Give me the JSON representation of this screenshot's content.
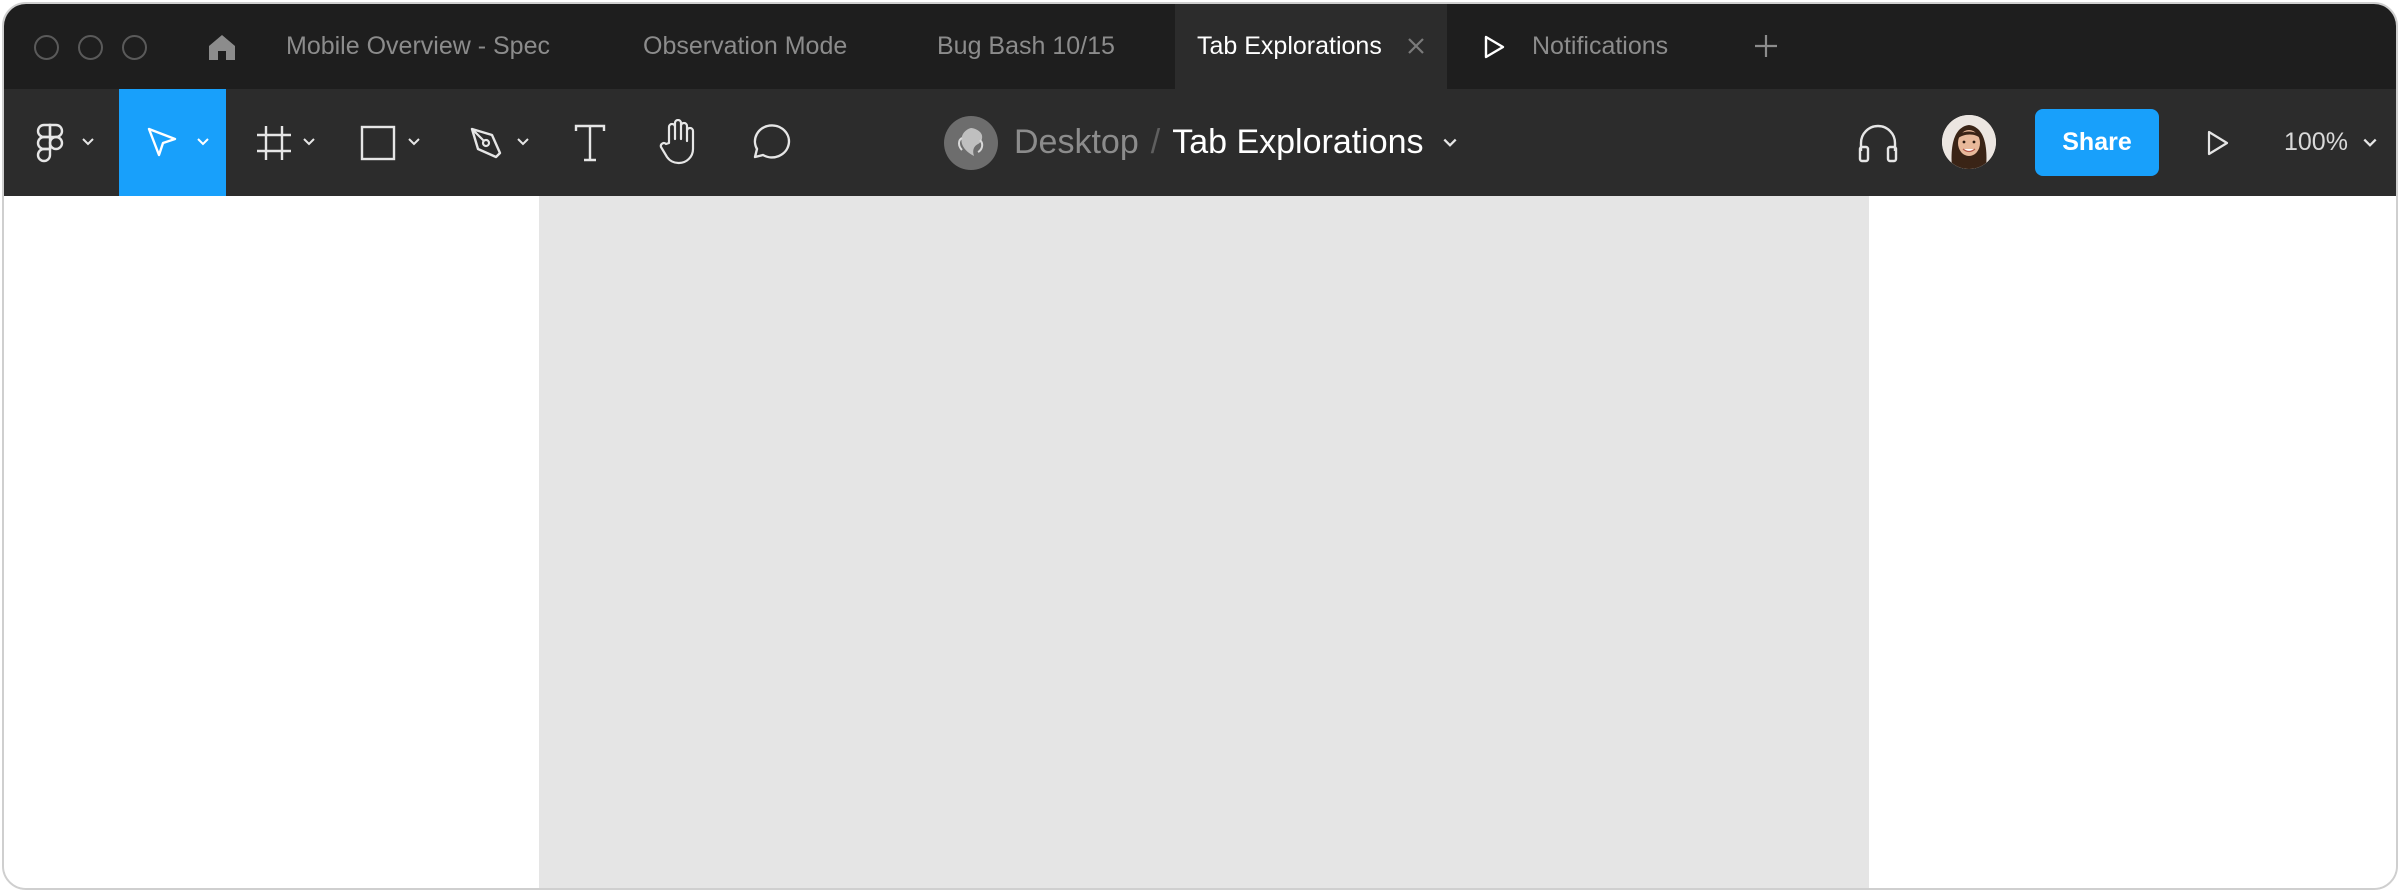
{
  "tabs": [
    {
      "label": "Mobile Overview - Spec"
    },
    {
      "label": "Observation Mode"
    },
    {
      "label": "Bug Bash 10/15"
    },
    {
      "label": "Tab Explorations"
    },
    {
      "label": "Notifications"
    }
  ],
  "breadcrumb": {
    "team": "Desktop",
    "separator": "/",
    "file": "Tab Explorations"
  },
  "share_label": "Share",
  "zoom_label": "100%",
  "colors": {
    "accent": "#18a0fb",
    "tabbar": "#1e1e1e",
    "toolbar": "#2c2c2c",
    "frame": "#e5e5e5"
  },
  "icons": [
    "home-icon",
    "close-icon",
    "play-icon",
    "plus-icon",
    "figma-logo-icon",
    "move-icon",
    "frame-icon",
    "rectangle-icon",
    "pen-icon",
    "text-icon",
    "hand-icon",
    "comment-icon",
    "headphones-icon",
    "avatar",
    "chevron-down-icon"
  ]
}
